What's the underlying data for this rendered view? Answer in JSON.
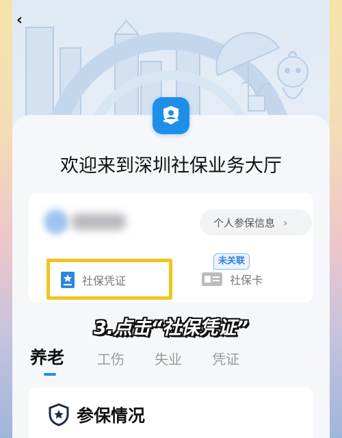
{
  "nav": {
    "back_icon": "chevron-left-icon",
    "back_glyph": "‹"
  },
  "header": {
    "welcome": "欢迎来到深圳社保业务大厅"
  },
  "user_card": {
    "info_button_label": "个人参保信息",
    "info_button_chevron": "›",
    "voucher_label": "社保凭证",
    "badge_label": "未关联",
    "social_card_label": "社保卡"
  },
  "annotation": {
    "caption": "3.点击“社保凭证”"
  },
  "tabs": [
    {
      "label": "养老",
      "active": true
    },
    {
      "label": "工伤",
      "active": false
    },
    {
      "label": "失业",
      "active": false
    },
    {
      "label": "凭证",
      "active": false
    }
  ],
  "section": {
    "title": "参保情况"
  },
  "colors": {
    "accent": "#1e8fe8",
    "highlight": "#f2c51d",
    "badge_text": "#2e7fd8"
  }
}
